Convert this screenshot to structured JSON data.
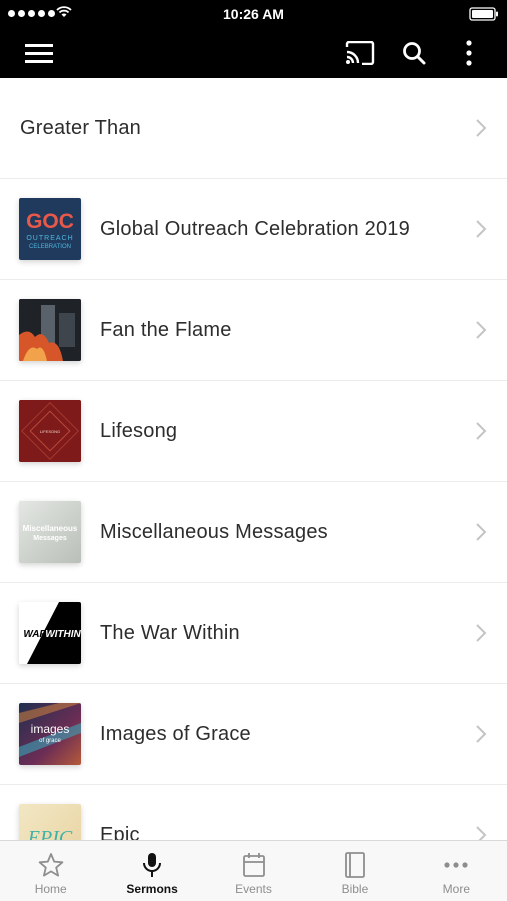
{
  "status_bar": {
    "time": "10:26 AM"
  },
  "list": {
    "items": [
      {
        "title": "Greater Than"
      },
      {
        "title": "Global Outreach Celebration 2019",
        "thumb_text": "GOC",
        "thumb_sub": "OUTREACH",
        "thumb_sub2": "CELEBRATION"
      },
      {
        "title": "Fan the Flame"
      },
      {
        "title": "Lifesong",
        "thumb_text": "LIFESONG"
      },
      {
        "title": "Miscellaneous Messages",
        "thumb_text": "Miscellaneous",
        "thumb_sub": "Messages"
      },
      {
        "title": "The War Within",
        "thumb_text": "WAR",
        "thumb_sub": "WITHIN"
      },
      {
        "title": "Images of Grace",
        "thumb_text": "images",
        "thumb_sub": "of grace"
      },
      {
        "title": "Epic",
        "thumb_text": "EPIC"
      }
    ]
  },
  "tabs": [
    {
      "label": "Home",
      "icon": "star-icon"
    },
    {
      "label": "Sermons",
      "icon": "microphone-icon",
      "active": true
    },
    {
      "label": "Events",
      "icon": "calendar-icon"
    },
    {
      "label": "Bible",
      "icon": "book-icon"
    },
    {
      "label": "More",
      "icon": "more-dots-icon"
    }
  ],
  "colors": {
    "header_bg": "#000000",
    "tab_active": "#111111",
    "tab_inactive": "#8e8e8e"
  }
}
